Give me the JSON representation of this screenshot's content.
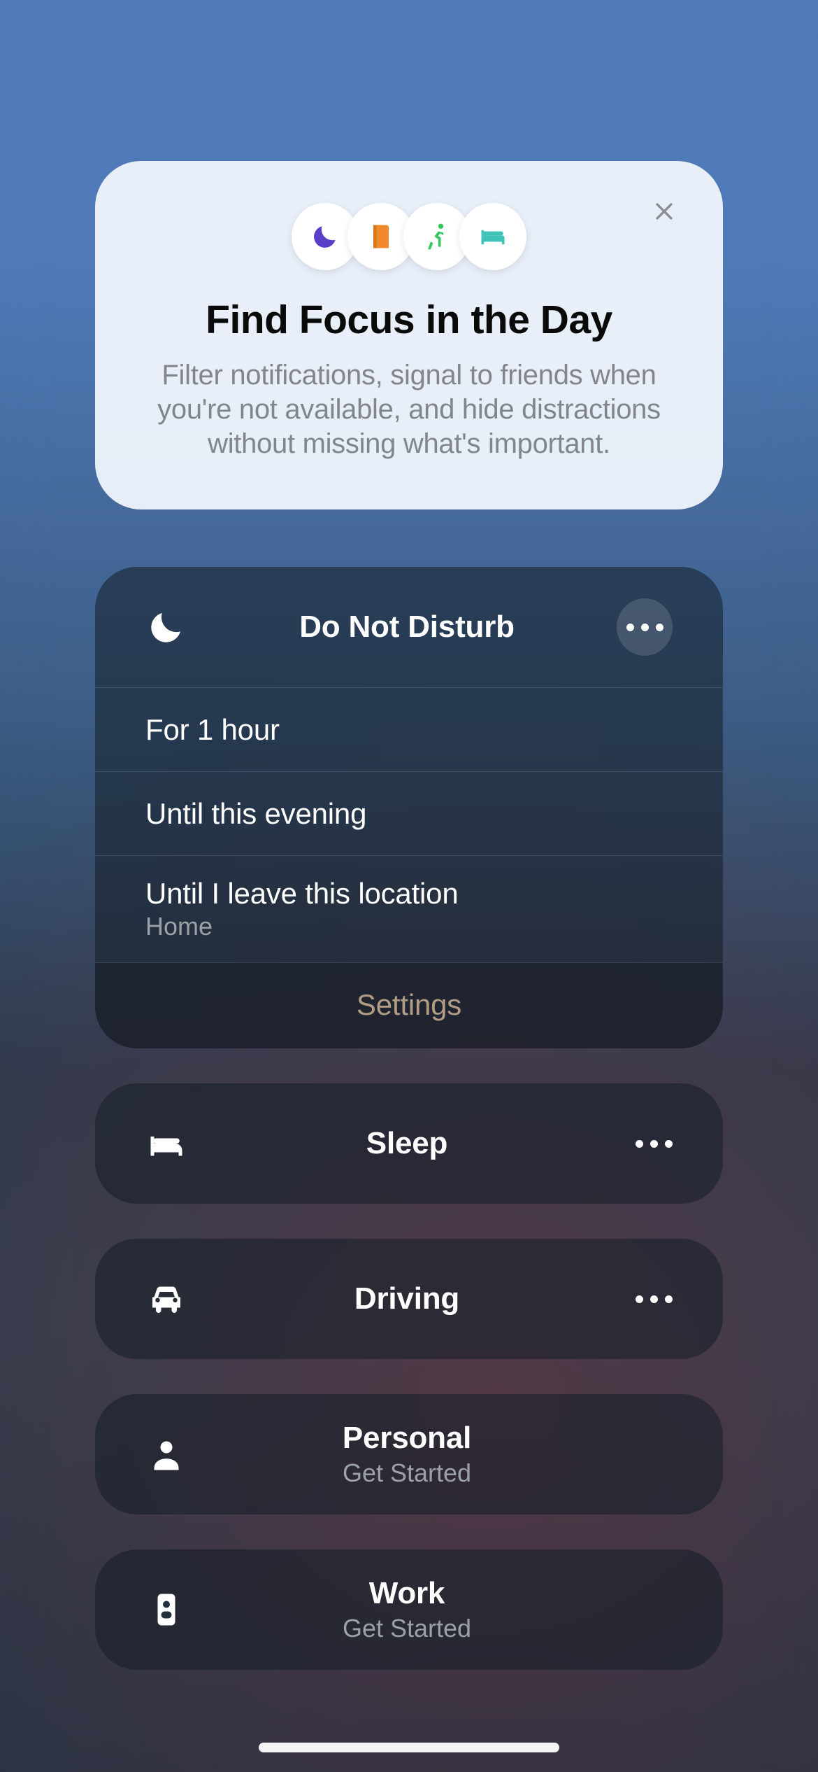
{
  "promo": {
    "title": "Find Focus in the Day",
    "body": "Filter notifications, signal to friends when you're not available, and hide distractions without missing what's important.",
    "icons": [
      "moon",
      "book",
      "running",
      "bed"
    ]
  },
  "dnd": {
    "label": "Do Not Disturb",
    "options": [
      {
        "primary": "For 1 hour"
      },
      {
        "primary": "Until this evening"
      },
      {
        "primary": "Until I leave this location",
        "secondary": "Home"
      }
    ],
    "settings_label": "Settings"
  },
  "modes": [
    {
      "icon": "bed",
      "label": "Sleep",
      "more": true
    },
    {
      "icon": "car",
      "label": "Driving",
      "more": true
    },
    {
      "icon": "person",
      "label": "Personal",
      "sub": "Get Started"
    },
    {
      "icon": "badge",
      "label": "Work",
      "sub": "Get Started"
    }
  ]
}
